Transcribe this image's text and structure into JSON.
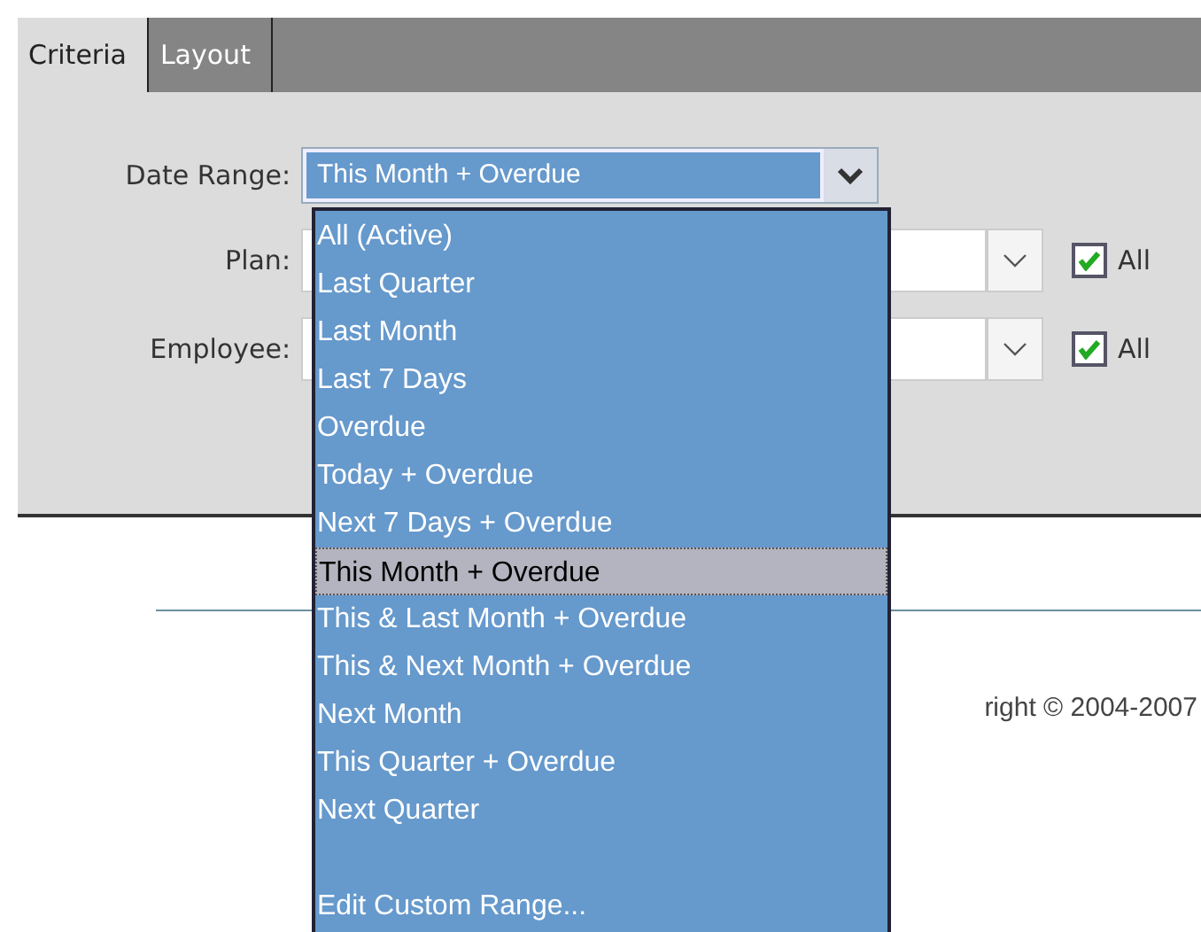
{
  "tabs": [
    {
      "label": "Criteria",
      "selected": true
    },
    {
      "label": "Layout",
      "selected": false
    }
  ],
  "criteria": {
    "date_range": {
      "label": "Date Range:",
      "value": "This Month + Overdue",
      "expanded": true
    },
    "fields": [
      {
        "label": "Plan:",
        "all_label": "All",
        "all_checked": true
      },
      {
        "label": "Employee:",
        "all_label": "All",
        "all_checked": true
      }
    ]
  },
  "date_range_options": [
    {
      "kind": "option",
      "label": "All (Active)",
      "selected": false
    },
    {
      "kind": "option",
      "label": "Last Quarter",
      "selected": false
    },
    {
      "kind": "option",
      "label": "Last Month",
      "selected": false
    },
    {
      "kind": "option",
      "label": "Last 7 Days",
      "selected": false
    },
    {
      "kind": "option",
      "label": "Overdue",
      "selected": false
    },
    {
      "kind": "option",
      "label": "Today + Overdue",
      "selected": false
    },
    {
      "kind": "option",
      "label": "Next 7 Days + Overdue",
      "selected": false
    },
    {
      "kind": "option",
      "label": "This Month + Overdue",
      "selected": true
    },
    {
      "kind": "option",
      "label": "This & Last Month + Overdue",
      "selected": false
    },
    {
      "kind": "option",
      "label": "This & Next Month + Overdue",
      "selected": false
    },
    {
      "kind": "option",
      "label": "Next Month",
      "selected": false
    },
    {
      "kind": "option",
      "label": "This Quarter + Overdue",
      "selected": false
    },
    {
      "kind": "option",
      "label": "Next Quarter",
      "selected": false
    },
    {
      "kind": "blank"
    },
    {
      "kind": "option",
      "label": "Edit Custom Range...",
      "selected": false
    }
  ],
  "footer": {
    "copyright": "right © 2004-2007"
  }
}
